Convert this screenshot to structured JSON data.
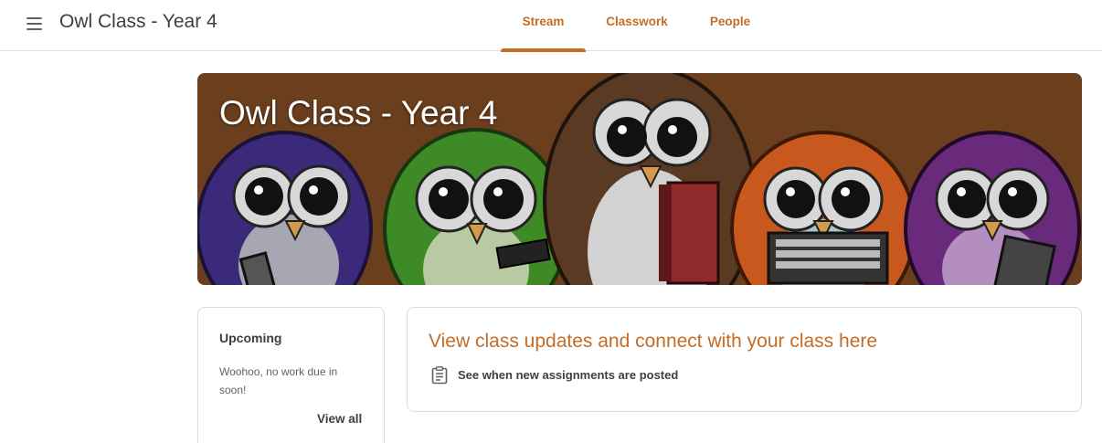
{
  "header": {
    "menu_icon": "hamburger-menu-icon",
    "title": "Owl Class - Year 4",
    "tabs": [
      {
        "label": "Stream",
        "active": true
      },
      {
        "label": "Classwork",
        "active": false
      },
      {
        "label": "People",
        "active": false
      }
    ]
  },
  "banner": {
    "title": "Owl Class - Year 4",
    "image": "cartoon-owls-illustration"
  },
  "upcoming": {
    "title": "Upcoming",
    "text": "Woohoo, no work due in soon!",
    "view_all": "View all"
  },
  "updates": {
    "title": "View class updates and connect with your class here",
    "row_icon": "assignment-icon",
    "row_text": "See when new assignments are posted"
  },
  "colors": {
    "accent": "#c46d27",
    "banner_bg": "#6b3f1d",
    "text": "#3c4043"
  }
}
